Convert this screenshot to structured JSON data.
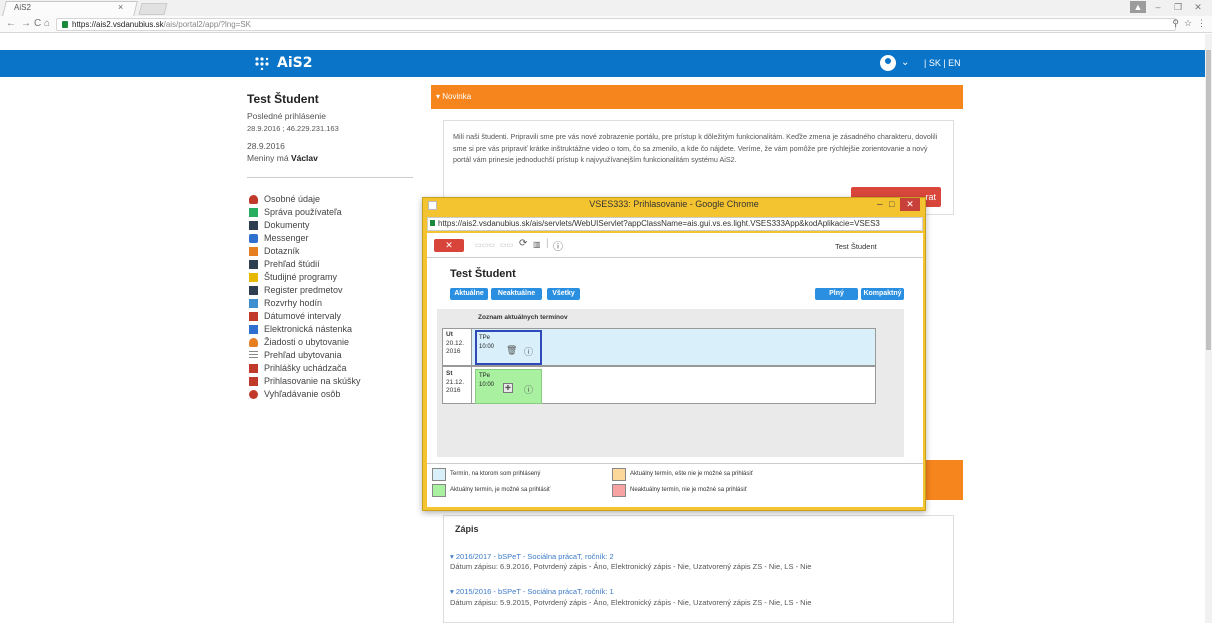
{
  "browser": {
    "tab_title": "AiS2",
    "tab_close": "×",
    "url_host": "https://ais2.vsdanubius.sk",
    "url_path": "/ais/portal2/app/?lng=SK"
  },
  "header": {
    "logo": "AiS2",
    "lang": "| SK | EN"
  },
  "student": {
    "name": "Test Študent",
    "last_login_label": "Posledné prihlásenie",
    "last_login_value": "28.9.2016 ; 46.229.231.163",
    "date": "28.9.2016",
    "nameday_prefix": "Meniny má ",
    "nameday_name": "Václav"
  },
  "menu": [
    {
      "label": "Osobné údaje",
      "color": "#c0392b"
    },
    {
      "label": "Správa používateľa",
      "color": "#27ae60"
    },
    {
      "label": "Dokumenty",
      "color": "#2c3e50"
    },
    {
      "label": "Messenger",
      "color": "#2e6fd0"
    },
    {
      "label": "Dotazník",
      "color": "#e67e22"
    },
    {
      "label": "Prehľad štúdií",
      "color": "#2c3e50"
    },
    {
      "label": "Študijné programy",
      "color": "#e6b800"
    },
    {
      "label": "Register predmetov",
      "color": "#2c3e50"
    },
    {
      "label": "Rozvrhy hodín",
      "color": "#3d8fd0"
    },
    {
      "label": "Dátumové intervaly",
      "color": "#c0392b"
    },
    {
      "label": "Elektronická nástenka",
      "color": "#2e6fd0"
    },
    {
      "label": "Žiadosti o ubytovanie",
      "color": "#e67e22"
    },
    {
      "label": "Prehľad ubytovania",
      "color": "#888888"
    },
    {
      "label": "Prihlášky uchádzača",
      "color": "#c0392b"
    },
    {
      "label": "Prihlasovanie na skúšky",
      "color": "#c0392b"
    },
    {
      "label": "Vyhľadávanie osôb",
      "color": "#c0392b"
    }
  ],
  "news": {
    "title": "Novinka",
    "text": "Milí naši študenti. Pripravili sme pre vás nové zobrazenie portálu, pre prístup k dôležitým funkcionalitám. Keďže zmena je zásadného charakteru, dovolili sme si pre vás pripraviť krátke inštruktážne video o tom, čo sa zmenilo, a kde čo nájdete. Veríme, že vám pomôže pre rýchlejšie zorientovanie a nový portál vám prinesie jednoduchší prístup k najvyužívanejším funkcionalitám systému AiS2.",
    "button": "rat"
  },
  "zapis": {
    "title": "Zápis",
    "entries": [
      {
        "link": "▾ 2016/2017 - bSPeT - Sociálna prácaT, ročník: 2",
        "desc": "Dátum zápisu: 6.9.2016, Potvrdený zápis - Áno, Elektronický zápis - Nie, Uzatvorený zápis ZS - Nie, LS - Nie"
      },
      {
        "link": "▾ 2015/2016 - bSPeT - Sociálna prácaT, ročník: 1",
        "desc": "Dátum zápisu: 5.9.2015, Potvrdený zápis - Áno, Elektronický zápis - Nie, Uzatvorený zápis ZS - Nie, LS - Nie"
      }
    ]
  },
  "popup": {
    "title": "VSES333: Prihlasovanie - Google Chrome",
    "url": "https://ais2.vsdanubius.sk/ais/servlets/WebUIServlet?appClassName=ais.gui.vs.es.light.VSES333App&kodAplikacie=VSES3",
    "user": "Test Študent",
    "student_name": "Test Študent",
    "btn_aktualne": "Aktuálne",
    "btn_neaktualne": "Neaktuálne",
    "btn_vsetky": "Všetky",
    "btn_plny": "Plný",
    "btn_kompaktny": "Kompaktný",
    "list_title": "Zoznam aktuálnych termínov",
    "rows": [
      {
        "day": "Ut",
        "date1": "20.12.",
        "date2": "2016",
        "term": "TPe",
        "time": "10:00"
      },
      {
        "day": "St",
        "date1": "21.12.",
        "date2": "2016",
        "term": "TPe",
        "time": "10:00"
      }
    ],
    "legend": [
      {
        "text": "Termín, na ktorom som prihlásený",
        "color": "#d9f0fb"
      },
      {
        "text": "Aktuálny termín, je možné sa prihlásiť",
        "color": "#a9f0a1"
      },
      {
        "text": "Aktuálny termín, ešte nie je možné sa prihlásiť",
        "color": "#fcd99a"
      },
      {
        "text": "Neaktuálny termín, nie je možné sa prihlásiť",
        "color": "#f7a3a3"
      }
    ]
  }
}
